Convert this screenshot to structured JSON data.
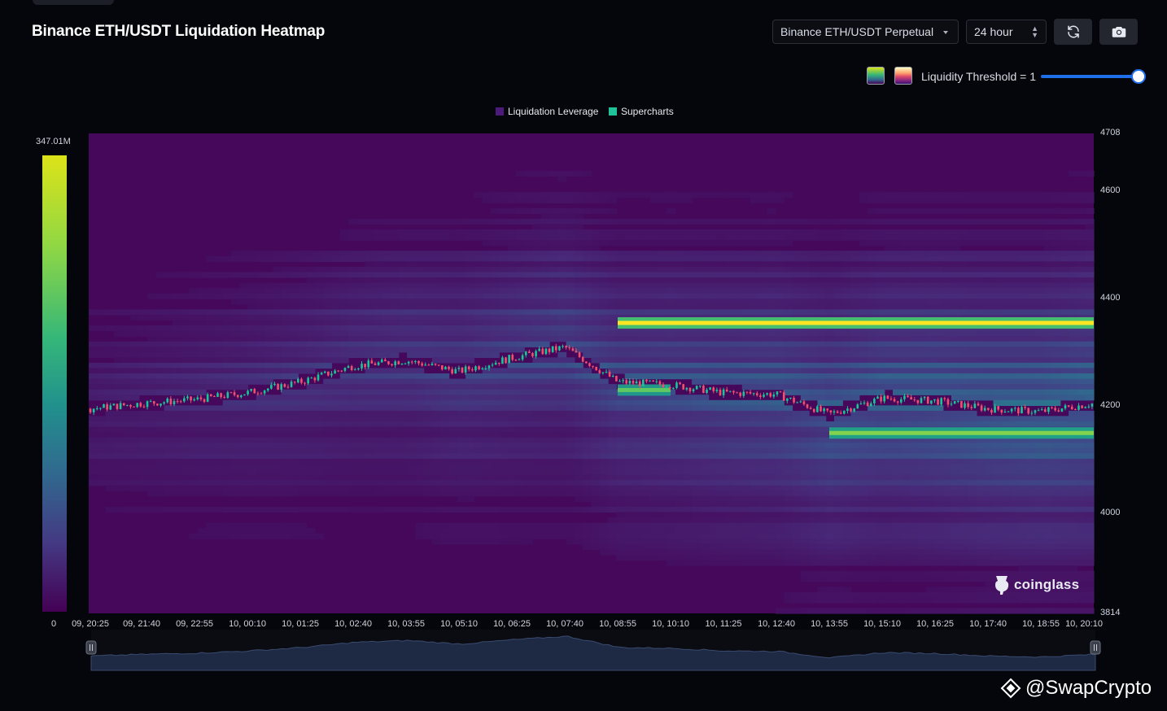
{
  "header": {
    "title": "Binance ETH/USDT Liquidation Heatmap",
    "exchange_select": "Binance ETH/USDT Perpetual",
    "interval_select": "24 hour",
    "refresh_icon": "refresh-icon",
    "camera_icon": "camera-icon"
  },
  "controls": {
    "palette_options": [
      "viridis",
      "magma"
    ],
    "threshold_label": "Liquidity Threshold = 1",
    "threshold_value": 1.0
  },
  "legend": {
    "items": [
      "Liquidation Leverage",
      "Supercharts"
    ],
    "colors": [
      "#4b1a7a",
      "#20c29a"
    ]
  },
  "colorscale": {
    "max_label": "347.01M",
    "min_label": "0"
  },
  "brand": "coinglass",
  "watermark": "@SwapCrypto",
  "chart_data": {
    "type": "heatmap",
    "title": "Binance ETH/USDT Liquidation Heatmap",
    "y_ticks": [
      "4708",
      "4600",
      "4400",
      "4200",
      "4000",
      "3814"
    ],
    "ylim": [
      3814,
      4708
    ],
    "x_ticks": [
      "09, 20:25",
      "09, 21:40",
      "09, 22:55",
      "10, 00:10",
      "10, 01:25",
      "10, 02:40",
      "10, 03:55",
      "10, 05:10",
      "10, 06:25",
      "10, 07:40",
      "10, 08:55",
      "10, 10:10",
      "10, 11:25",
      "10, 12:40",
      "10, 13:55",
      "10, 15:10",
      "10, 16:25",
      "10, 17:40",
      "10, 18:55",
      "10, 20:10"
    ],
    "color_range": [
      0,
      347.01
    ],
    "color_unit": "M",
    "price_series": {
      "name": "Supercharts",
      "points": [
        [
          "09, 20:25",
          4195
        ],
        [
          "09, 21:40",
          4205
        ],
        [
          "09, 22:55",
          4212
        ],
        [
          "10, 00:10",
          4225
        ],
        [
          "10, 01:25",
          4245
        ],
        [
          "10, 02:40",
          4275
        ],
        [
          "10, 03:55",
          4285
        ],
        [
          "10, 05:10",
          4265
        ],
        [
          "10, 06:25",
          4290
        ],
        [
          "10, 07:40",
          4310
        ],
        [
          "10, 08:55",
          4245
        ],
        [
          "10, 10:10",
          4240
        ],
        [
          "10, 11:25",
          4225
        ],
        [
          "10, 12:40",
          4222
        ],
        [
          "10, 13:55",
          4185
        ],
        [
          "10, 15:10",
          4215
        ],
        [
          "10, 16:25",
          4210
        ],
        [
          "10, 17:40",
          4195
        ],
        [
          "10, 18:55",
          4190
        ],
        [
          "10, 20:10",
          4205
        ]
      ]
    },
    "liquidation_bands": [
      {
        "price": 4355,
        "from": "10, 08:55",
        "to": "10, 20:10",
        "value": 347
      },
      {
        "price": 4150,
        "from": "10, 13:55",
        "to": "10, 20:10",
        "value": 280
      },
      {
        "price": 4230,
        "from": "10, 08:55",
        "to": "10, 10:10",
        "value": 260
      }
    ]
  }
}
